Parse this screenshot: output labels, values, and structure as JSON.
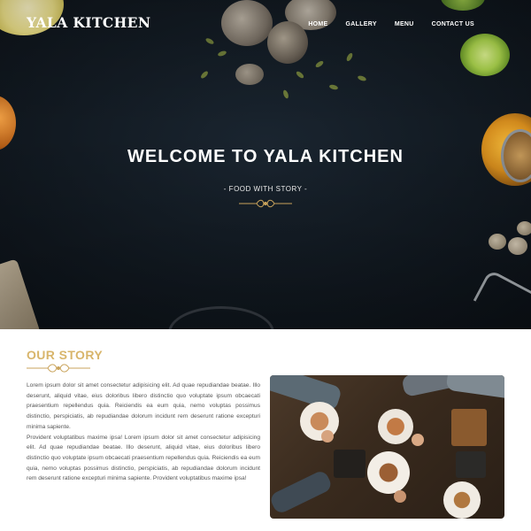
{
  "header": {
    "logo": "YALA KITCHEN",
    "nav": [
      "HOME",
      "GALLERY",
      "MENU",
      "CONTACT US"
    ]
  },
  "hero": {
    "title": "WELCOME TO YALA KITCHEN",
    "subtitle": "- FOOD WITH STORY -",
    "ornament_color": "#c9a35b"
  },
  "story": {
    "title": "OUR STORY",
    "title_color": "#d8b56b",
    "paragraphs": [
      "Lorem ipsum dolor sit amet consectetur adipisicing elit. Ad quae repudiandae beatae. Illo deserunt, aliquid vitae, eius doloribus libero distinctio quo voluptate ipsum obcaecati praesentium repellendus quia. Reiciendis ea eum quia, nemo voluptas possimus distinctio, perspiciatis, ab repudiandae dolorum incidunt rem deserunt ratione excepturi minima sapiente.",
      "Provident voluptatibus maxime ipsa! Lorem ipsum dolor sit amet consectetur adipisicing elit. Ad quae repudiandae beatae. Illo deserunt, aliquid vitae, eius doloribus libero distinctio quo voluptate ipsum obcaecati praesentium repellendus quia. Reiciendis ea eum quia, nemo voluptas possimus distinctio, perspiciatis, ab repudiandae dolorum incidunt rem deserunt ratione excepturi minima sapiente. Provident voluptatibus maxime ipsa!"
    ]
  }
}
